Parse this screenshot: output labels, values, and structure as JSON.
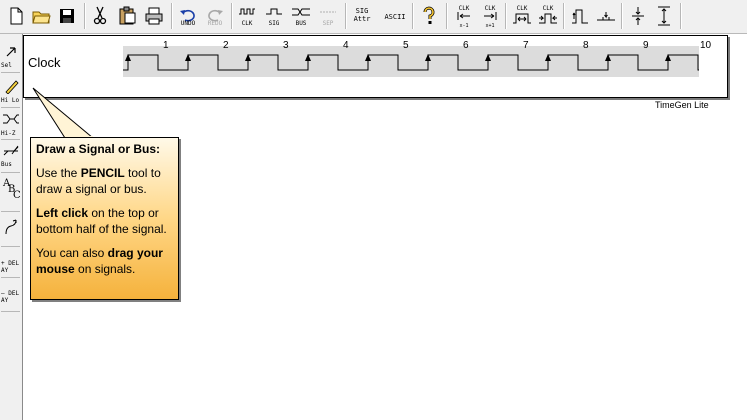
{
  "toolbar": {
    "buttons": [
      {
        "id": "new",
        "icon": "new-document-icon",
        "label": ""
      },
      {
        "id": "open",
        "icon": "open-folder-icon",
        "label": ""
      },
      {
        "id": "save",
        "icon": "floppy-disk-icon",
        "label": ""
      },
      {
        "id": "cut",
        "icon": "scissors-icon",
        "label": ""
      },
      {
        "id": "paste",
        "icon": "clipboard-icon",
        "label": ""
      },
      {
        "id": "print",
        "icon": "printer-icon",
        "label": ""
      },
      {
        "id": "undo",
        "icon": "undo-arrow-icon",
        "label": "UNDO",
        "enabled": true
      },
      {
        "id": "redo",
        "icon": "redo-arrow-icon",
        "label": "REDO",
        "enabled": false
      },
      {
        "id": "add-clock",
        "icon": "clock-wave-icon",
        "label": "CLK"
      },
      {
        "id": "add-signal",
        "icon": "signal-wave-icon",
        "label": "SIG"
      },
      {
        "id": "add-bus",
        "icon": "bus-wave-icon",
        "label": "BUS"
      },
      {
        "id": "add-separator",
        "icon": "separator-icon",
        "label": "SEP",
        "enabled": false
      },
      {
        "id": "signal-attributes",
        "label": "SIG Attr"
      },
      {
        "id": "ascii",
        "label": "ASCII"
      },
      {
        "id": "help",
        "icon": "question-mark-icon",
        "label": ""
      },
      {
        "id": "clk-shift-left",
        "icon": "clk-arrow-left-icon",
        "label": "CLK x-1"
      },
      {
        "id": "clk-shift-right",
        "icon": "clk-arrow-right-icon",
        "label": "CLK x+1"
      },
      {
        "id": "clk-expand",
        "icon": "clk-expand-icon",
        "label": "CLK"
      },
      {
        "id": "clk-compress",
        "icon": "clk-compress-icon",
        "label": "CLK"
      },
      {
        "id": "rising-edge",
        "icon": "rising-edge-icon",
        "label": ""
      },
      {
        "id": "falling-edge",
        "icon": "falling-edge-icon",
        "label": ""
      },
      {
        "id": "zoom-in",
        "icon": "arrows-converge-icon",
        "label": ""
      },
      {
        "id": "zoom-out",
        "icon": "arrows-diverge-icon",
        "label": ""
      }
    ]
  },
  "left_toolbar": {
    "tools": [
      {
        "id": "select",
        "icon": "select-arrow-icon",
        "label": "Sel"
      },
      {
        "id": "hilo",
        "icon": "pencil-icon",
        "label": "Hi Lo"
      },
      {
        "id": "hiz",
        "icon": "hi-z-wave-icon",
        "label": "Hi-Z"
      },
      {
        "id": "bus",
        "icon": "bus-tool-icon",
        "label": "Bus"
      },
      {
        "id": "text",
        "icon": "text-abc-icon",
        "label": ""
      },
      {
        "id": "arrow",
        "icon": "curved-arrow-icon",
        "label": ""
      },
      {
        "id": "add-delay",
        "label": "+ DELAY"
      },
      {
        "id": "remove-delay",
        "label": "– DELAY"
      }
    ]
  },
  "diagram": {
    "signal_name": "Clock",
    "cycles": [
      "1",
      "2",
      "3",
      "4",
      "5",
      "6",
      "7",
      "8",
      "9",
      "10"
    ]
  },
  "brand": "TimeGen Lite",
  "tip": {
    "title": "Draw a Signal or Bus:",
    "p1_a": "Use the ",
    "p1_b": "PENCIL",
    "p1_c": " tool to draw a signal or bus.",
    "p2_a": "Left click",
    "p2_b": " on the top or bottom half of the signal.",
    "p3_a": "You can also ",
    "p3_b": "drag your mouse",
    "p3_c": " on signals."
  },
  "colors": {
    "toolbar_bg": "#f0f0f0",
    "waveform_bg": "#dcdcdc",
    "tip_gradient_top": "#fff9e8",
    "tip_gradient_bottom": "#f5b23c"
  }
}
